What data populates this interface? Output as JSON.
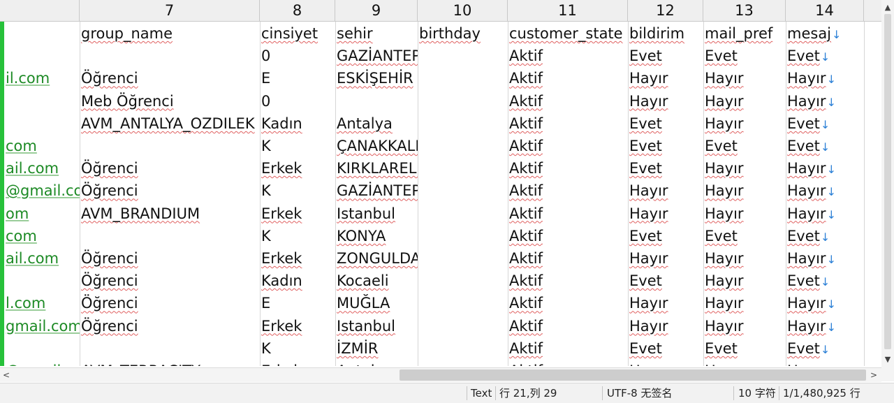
{
  "columns": [
    {
      "label": "7"
    },
    {
      "label": "8"
    },
    {
      "label": "9"
    },
    {
      "label": "10"
    },
    {
      "label": "11"
    },
    {
      "label": "12"
    },
    {
      "label": "13"
    },
    {
      "label": "14"
    }
  ],
  "header_row": [
    "",
    "group_name",
    "cinsiyet",
    "sehir",
    "birthday",
    "customer_state",
    "bildirim",
    "mail_pref",
    "mesaj"
  ],
  "rows": [
    [
      "",
      "",
      "0",
      "GAZİANTEP",
      "",
      "Aktif",
      "Evet",
      "Evet",
      "Evet"
    ],
    [
      "il.com",
      "Öğrenci",
      "E",
      "ESKİŞEHİR",
      "",
      "Aktif",
      "Hayır",
      "Hayır",
      "Hayır"
    ],
    [
      "",
      "Meb Öğrenci",
      "0",
      "",
      "",
      "Aktif",
      "Hayır",
      "Hayır",
      "Hayır"
    ],
    [
      "",
      "AVM_ANTALYA_OZDILEK",
      "Kadın",
      "Antalya",
      "",
      "Aktif",
      "Evet",
      "Hayır",
      "Evet"
    ],
    [
      "com",
      "",
      "K",
      "ÇANAKKALE",
      "",
      "Aktif",
      "Evet",
      "Evet",
      "Evet"
    ],
    [
      "ail.com",
      "Öğrenci",
      "Erkek",
      "KIRKLARELİ",
      "",
      "Aktif",
      "Evet",
      "Hayır",
      "Hayır"
    ],
    [
      "@gmail.com",
      "Öğrenci",
      "K",
      "GAZİANTEP",
      "",
      "Aktif",
      "Hayır",
      "Hayır",
      "Hayır"
    ],
    [
      "om",
      "AVM_BRANDIUM",
      "Erkek",
      "Istanbul",
      "",
      "Aktif",
      "Hayır",
      "Hayır",
      "Hayır"
    ],
    [
      "com",
      "",
      "K",
      "KONYA",
      "",
      "Aktif",
      "Evet",
      "Evet",
      "Evet"
    ],
    [
      "ail.com",
      "Öğrenci",
      "Erkek",
      "ZONGULDAK",
      "",
      "Aktif",
      "Hayır",
      "Hayır",
      "Hayır"
    ],
    [
      "",
      "Öğrenci",
      "Kadın",
      "Kocaeli",
      "",
      "Aktif",
      "Evet",
      "Hayır",
      "Evet"
    ],
    [
      "l.com",
      "Öğrenci",
      "E",
      "MUĞLA",
      "",
      "Aktif",
      "Hayır",
      "Hayır",
      "Hayır"
    ],
    [
      "gmail.com",
      "Öğrenci",
      "Erkek",
      "Istanbul",
      "",
      "Aktif",
      "Hayır",
      "Hayır",
      "Hayır"
    ],
    [
      "",
      "",
      "K",
      "İZMİR",
      "",
      "Aktif",
      "Evet",
      "Evet",
      "Evet"
    ],
    [
      "@gmail",
      "AVM_TERRACITY",
      "Erkek",
      "Antalya",
      "",
      "Aktif",
      "Hayır",
      "Hayır",
      "Hayır"
    ]
  ],
  "row_end_marker": "↓",
  "status": {
    "mode": "Text",
    "position": "行 21,列 29",
    "encoding": "UTF-8 无签名",
    "chars": "10 字符",
    "lines": "1/1,480,925 行"
  },
  "colors": {
    "accent_green": "#27c13a",
    "link_green": "#1d8a25",
    "arrow_blue": "#2a7fd6"
  }
}
